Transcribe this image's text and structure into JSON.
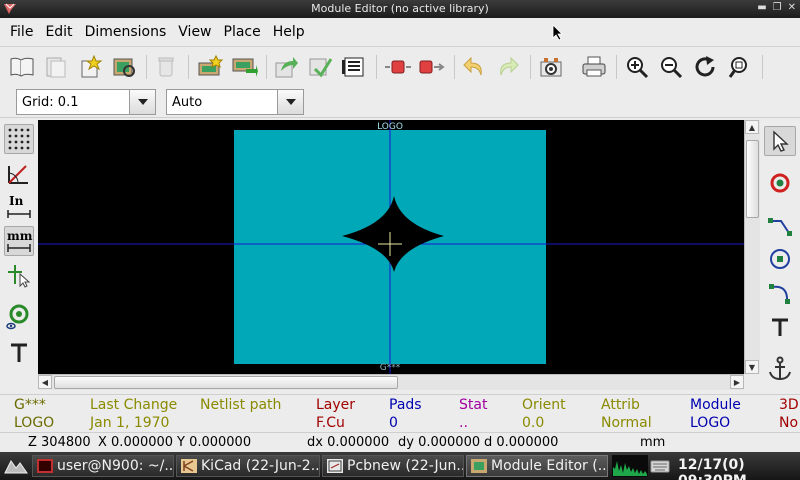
{
  "window": {
    "title": "Module Editor (no active library)"
  },
  "menubar": {
    "items": [
      "File",
      "Edit",
      "Dimensions",
      "View",
      "Place",
      "Help"
    ]
  },
  "optbar": {
    "grid_value": "Grid: 0.1",
    "zoom_value": "Auto"
  },
  "canvas": {
    "reference_label": "LOGO",
    "value_label": "G***"
  },
  "message_panel": {
    "columns": [
      {
        "header": "G***",
        "value": "LOGO",
        "color": "#6b6b00"
      },
      {
        "header": "Last Change",
        "value": "Jan 1, 1970",
        "color": "#8a8a00"
      },
      {
        "header": "Netlist path",
        "value": "",
        "color": "#8a8a00"
      },
      {
        "header": "Layer",
        "value": "F.Cu",
        "color": "#a00000"
      },
      {
        "header": "Pads",
        "value": "0",
        "color": "#0000b0"
      },
      {
        "header": "Stat",
        "value": "..",
        "color": "#a000a0"
      },
      {
        "header": "Orient",
        "value": "0.0",
        "color": "#8a8a00"
      },
      {
        "header": "Attrib",
        "value": "Normal",
        "color": "#8a8a00"
      },
      {
        "header": "Module",
        "value": "LOGO",
        "color": "#0000b0"
      },
      {
        "header": "3D",
        "value": "No",
        "color": "#a00000"
      }
    ]
  },
  "statusbar": {
    "zoom": "Z 304800",
    "x": "X 0.000000",
    "y": "Y 0.000000",
    "dx": "dx 0.000000",
    "dy": "dy 0.000000",
    "d": "d 0.000000",
    "units": "mm"
  },
  "taskbar": {
    "tasks": [
      {
        "label": "user@N900: ~/..."
      },
      {
        "label": "KiCad (22-Jun-2..."
      },
      {
        "label": "Pcbnew (22-Jun..."
      },
      {
        "label": "Module Editor (..."
      }
    ],
    "clock": "12/17(0) 09:30PM"
  },
  "left_tools": {
    "units_in_label": "In",
    "units_mm_label": "mm"
  },
  "colors": {
    "board": "#00a8b8",
    "canvas_bg": "#000000",
    "axis_line": "#1a1ad0"
  },
  "icons": [
    "open-library-icon",
    "save-library-icon",
    "new-module-icon",
    "load-module-icon",
    "delete-icon",
    "new-footprint-icon",
    "insert-footprint-icon",
    "export-icon",
    "import-icon",
    "properties-icon",
    "pad-settings-icon",
    "anchor-settings-icon",
    "undo-icon",
    "redo-icon",
    "settings-icon",
    "print-icon",
    "zoom-in-icon",
    "zoom-out-icon",
    "redraw-icon",
    "zoom-fit-icon"
  ]
}
